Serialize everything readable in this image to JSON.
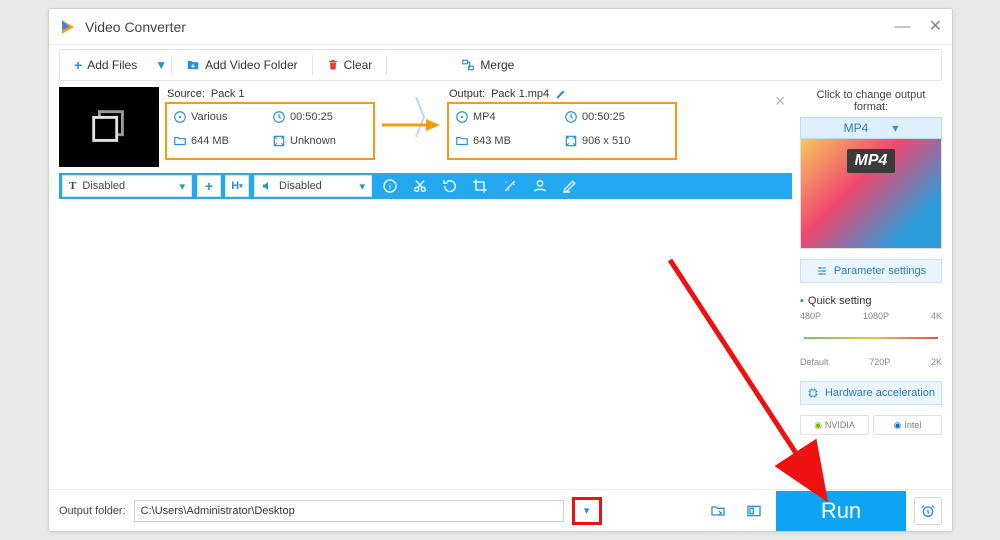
{
  "app": {
    "title": "Video Converter"
  },
  "toolbar": {
    "add_files": "Add Files",
    "add_folder": "Add Video Folder",
    "clear": "Clear",
    "merge": "Merge"
  },
  "item": {
    "source": {
      "label_prefix": "Source:",
      "name": "Pack 1",
      "format": "Various",
      "duration": "00:50:25",
      "size": "644 MB",
      "resolution": "Unknown"
    },
    "output": {
      "label_prefix": "Output:",
      "name": "Pack 1.mp4",
      "format": "MP4",
      "duration": "00:50:25",
      "size": "643 MB",
      "resolution": "906 x 510"
    }
  },
  "strip": {
    "subtitle_mode": "Disabled",
    "audio_mode": "Disabled"
  },
  "side": {
    "title": "Click to change output format:",
    "format": "MP4",
    "param_btn": "Parameter settings",
    "quick_title": "Quick setting",
    "scale_top": [
      "480P",
      "1080P",
      "4K"
    ],
    "scale_bot": [
      "Default",
      "720P",
      "2K"
    ],
    "hw_btn": "Hardware acceleration",
    "vendors": [
      "NVIDIA",
      "Intel"
    ]
  },
  "footer": {
    "label": "Output folder:",
    "path": "C:\\Users\\Administrator\\Desktop",
    "run": "Run"
  }
}
